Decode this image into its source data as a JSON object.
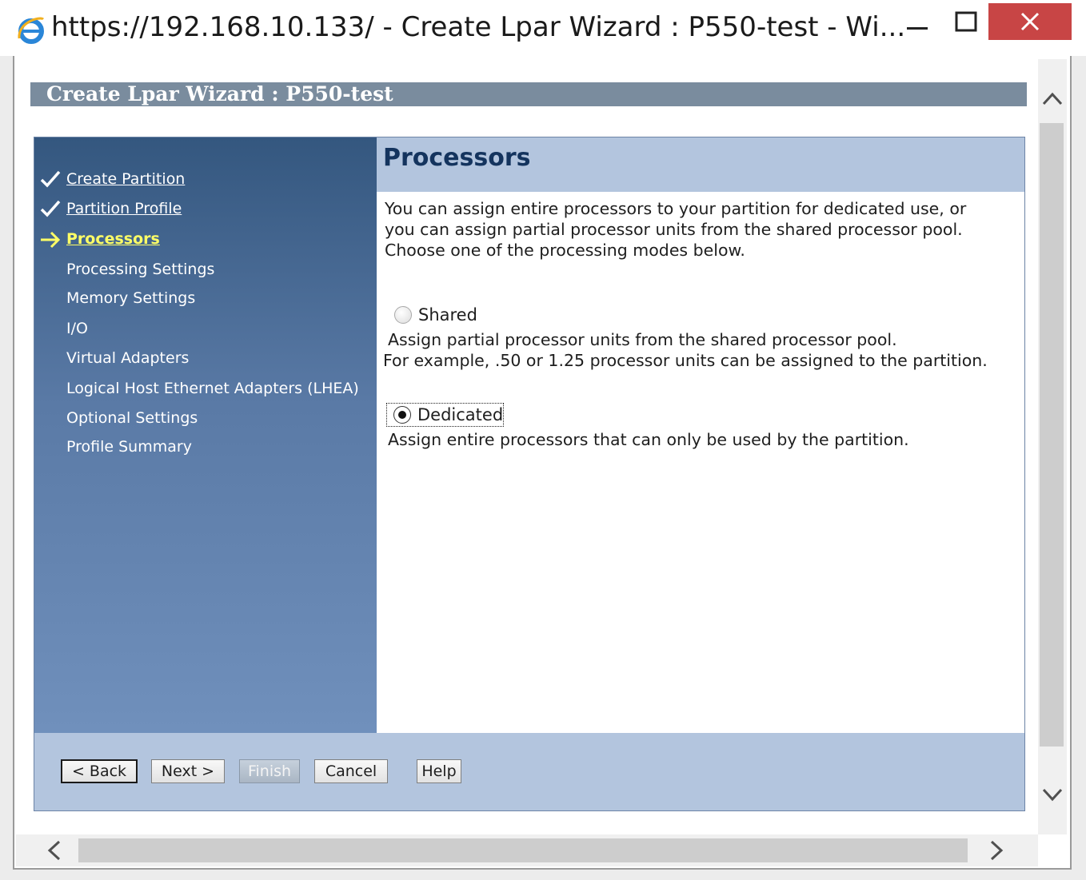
{
  "window": {
    "title": "https://192.168.10.133/ - Create Lpar Wizard : P550-test - Wi...",
    "controls": [
      "minimize-icon",
      "maximize-icon",
      "close-icon"
    ],
    "close_color": "#c84545"
  },
  "wizard": {
    "header": "Create Lpar Wizard : P550-test",
    "steps": [
      {
        "label": "Create Partition",
        "state": "done"
      },
      {
        "label": "Partition Profile",
        "state": "done"
      },
      {
        "label": "Processors",
        "state": "current"
      },
      {
        "label": "Processing Settings",
        "state": "pending"
      },
      {
        "label": "Memory Settings",
        "state": "pending"
      },
      {
        "label": "I/O",
        "state": "pending"
      },
      {
        "label": "Virtual Adapters",
        "state": "pending"
      },
      {
        "label": "Logical Host Ethernet Adapters (LHEA)",
        "state": "pending"
      },
      {
        "label": "Optional Settings",
        "state": "pending"
      },
      {
        "label": "Profile Summary",
        "state": "pending"
      }
    ]
  },
  "panel": {
    "title": "Processors",
    "description": [
      "You can assign entire processors to your partition for dedicated use, or",
      "you can assign partial processor units from the shared processor pool.",
      "Choose one of the processing modes below."
    ],
    "options": [
      {
        "label": "Shared",
        "checked": false,
        "desc": [
          "Assign partial processor units from the shared processor pool.",
          "For example, .50 or 1.25 processor units can be assigned to the partition."
        ]
      },
      {
        "label": "Dedicated",
        "checked": true,
        "desc": [
          "Assign entire processors that can only be used by the partition."
        ]
      }
    ]
  },
  "footer": {
    "back": "< Back",
    "next": "Next >",
    "finish": "Finish",
    "cancel": "Cancel",
    "help": "Help"
  },
  "colors": {
    "header_bar": "#7a8c9e",
    "nav_top": "#34577f",
    "nav_bottom": "#7090bc",
    "current_step": "#ffff66",
    "panel_bar": "#b3c5de",
    "title_text": "#14345e"
  }
}
